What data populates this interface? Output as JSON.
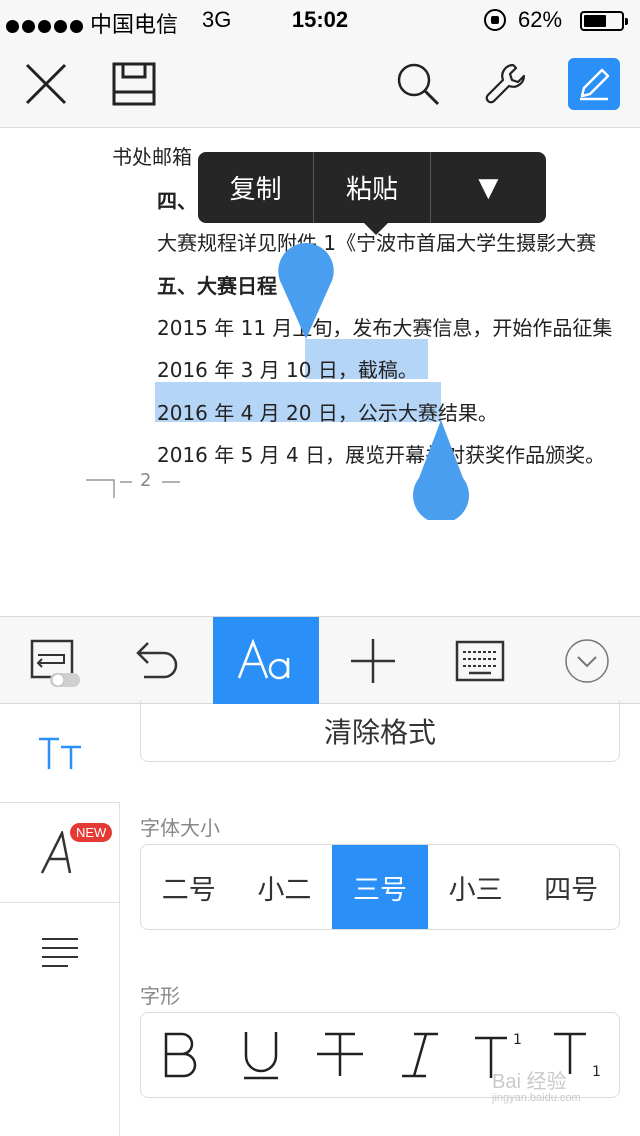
{
  "status_bar": {
    "carrier": "中国电信",
    "network": "3G",
    "time": "15:02",
    "battery_text": "62%",
    "battery_level": 0.62
  },
  "toolbar": {
    "icons": [
      "close-icon",
      "save-icon",
      "search-icon",
      "wrench-icon",
      "edit-pencil-icon"
    ],
    "accent": "#2a8ff7"
  },
  "document": {
    "lines": [
      "书处邮箱",
      "四、",
      "大赛规程详见附件 1《宁波市首届大学生摄影大赛",
      "五、大赛日程",
      "2015 年 11 月上旬，发布大赛信息，开始作品征集",
      "2016 年 3 月 10 日，截稿。",
      "2016 年 4 月 20 日，公示大赛结果。",
      "2016 年 5 月 4 日，展览开幕并对获奖作品颁奖。"
    ],
    "page_number": "2",
    "selection_color": "#b5d5f7"
  },
  "context_menu": {
    "copy": "复制",
    "paste": "粘贴",
    "more": "▼"
  },
  "format_bar": {
    "icons": [
      "wrap-toggle-icon",
      "undo-icon",
      "font-format-icon",
      "insert-plus-icon",
      "keyboard-icon",
      "collapse-chevron-icon"
    ],
    "active_index": 2
  },
  "side_tabs": {
    "new_badge": "NEW"
  },
  "panel": {
    "clear_format": "清除格式",
    "font_size_label": "字体大小",
    "font_sizes": [
      "二号",
      "小二",
      "三号",
      "小三",
      "四号"
    ],
    "selected_font_size": "三号",
    "font_style_label": "字形",
    "font_styles": [
      "B",
      "U",
      "T",
      "I",
      "T",
      "T"
    ],
    "superscript": "1",
    "subscript": "1"
  },
  "watermark": {
    "text": "Bai 经验",
    "url": "jingyan.baidu.com"
  }
}
